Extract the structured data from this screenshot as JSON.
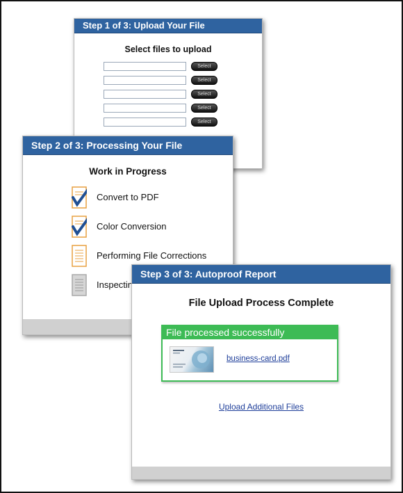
{
  "step1": {
    "header": "Step 1 of 3: Upload Your File",
    "title": "Select files to upload",
    "select_label": "Select",
    "file_rows": [
      {
        "value": "",
        "select_label": "Select"
      },
      {
        "value": "",
        "select_label": "Select"
      },
      {
        "value": "",
        "select_label": "Select"
      },
      {
        "value": "",
        "select_label": "Select"
      },
      {
        "value": "",
        "select_label": "Select"
      }
    ]
  },
  "step2": {
    "header": "Step 2 of 3: Processing Your File",
    "title": "Work in Progress",
    "tasks": [
      {
        "label": "Convert to PDF",
        "status": "complete",
        "icon": "checked-document-icon"
      },
      {
        "label": "Color Conversion",
        "status": "complete",
        "icon": "checked-document-icon"
      },
      {
        "label": "Performing File Corrections",
        "status": "in-progress",
        "icon": "document-icon"
      },
      {
        "label": "Inspecting",
        "status": "pending",
        "icon": "gray-document-icon"
      }
    ]
  },
  "step3": {
    "header": "Step 3 of 3: Autoproof Report",
    "title": "File Upload Process Complete",
    "success_message": "File processed successfully",
    "file_name": "business-card.pdf",
    "upload_more_label": "Upload Additional Files"
  },
  "colors": {
    "header_blue": "#2f63a0",
    "success_green": "#3dbb55",
    "link_blue": "#1d3d99",
    "check_blue": "#1f4f93",
    "doc_orange": "#e8a040"
  }
}
